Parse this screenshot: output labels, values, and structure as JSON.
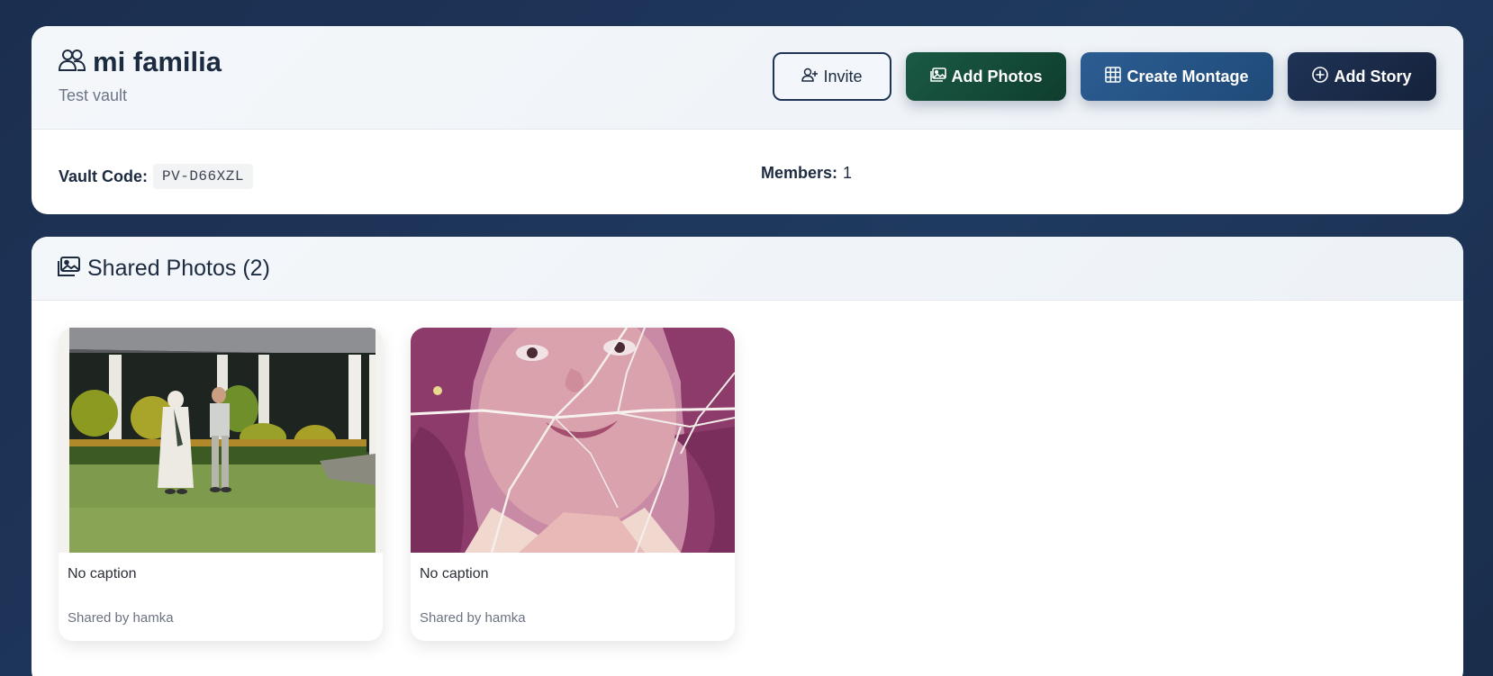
{
  "vault": {
    "name": "mi familia",
    "description": "Test vault",
    "code_label": "Vault Code:",
    "code": "PV-D66XZL",
    "members_label": "Members:",
    "members_count": "1"
  },
  "actions": {
    "invite": "Invite",
    "add_photos": "Add Photos",
    "create_montage": "Create Montage",
    "add_story": "Add Story"
  },
  "photos_section": {
    "title": "Shared Photos (2)",
    "items": [
      {
        "caption": "No caption",
        "shared_by": "Shared by hamka"
      },
      {
        "caption": "No caption",
        "shared_by": "Shared by hamka"
      }
    ]
  },
  "colors": {
    "page_bg": "#1b2e4f",
    "add_photos": "#1a5a44",
    "create_montage": "#2c5d92",
    "add_story": "#1f3356"
  },
  "icons": {
    "vault": "people-icon",
    "invite": "person-plus-icon",
    "add_photos": "images-icon",
    "create_montage": "grid-icon",
    "add_story": "plus-circle-icon",
    "section": "images-icon"
  }
}
